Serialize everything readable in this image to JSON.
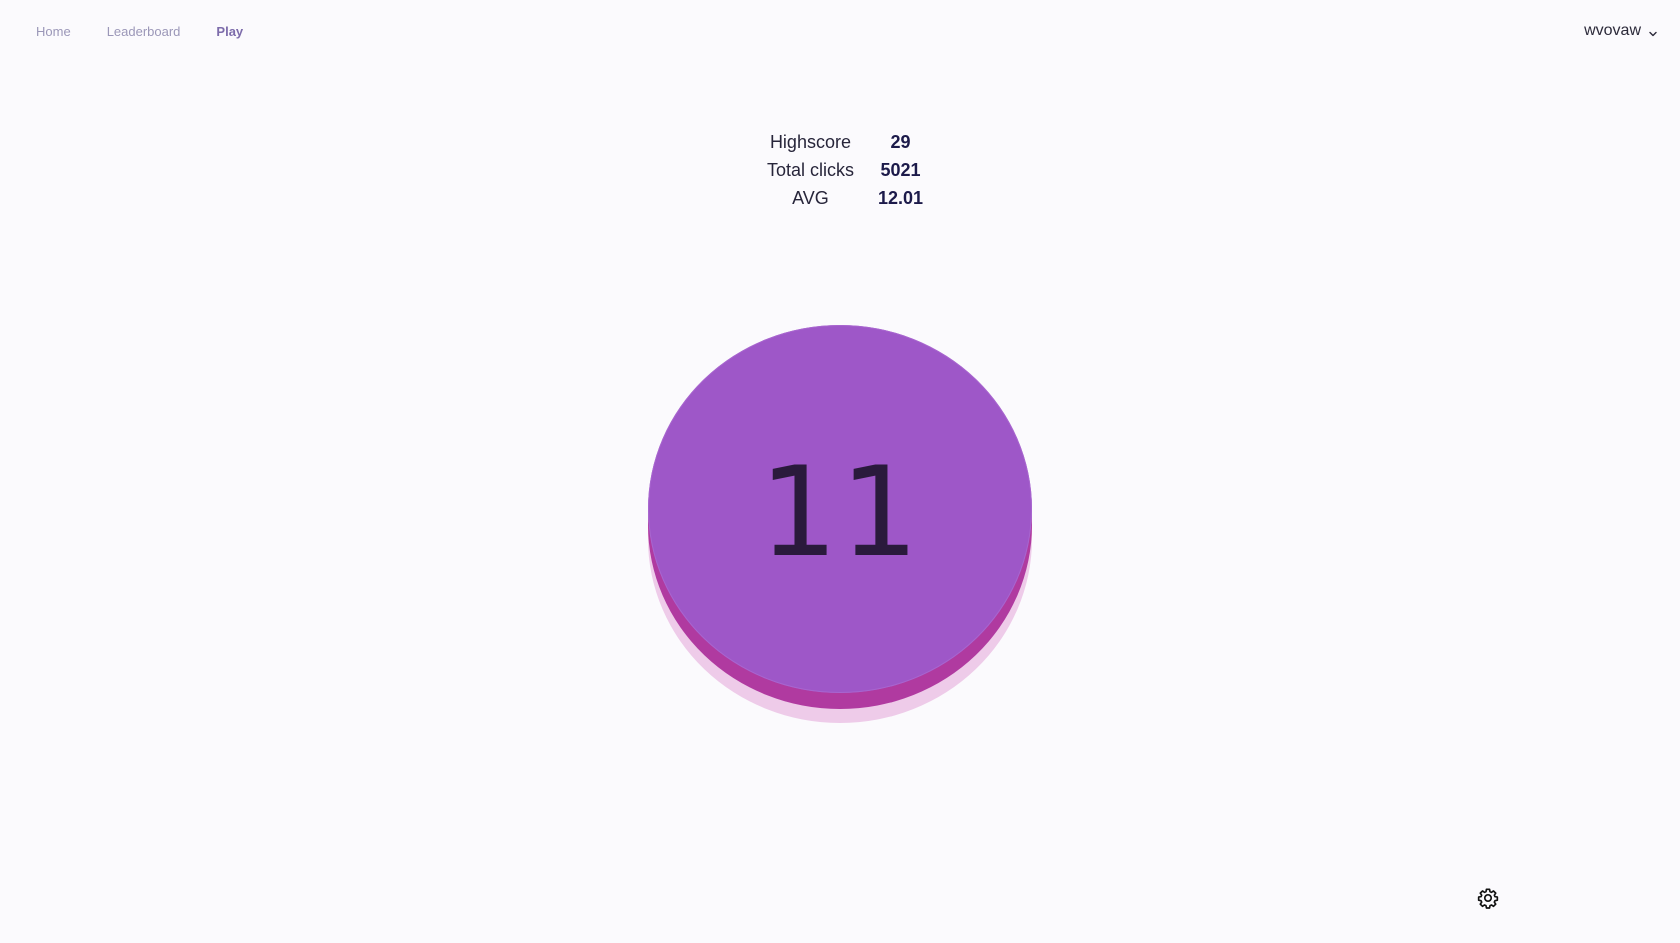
{
  "nav": {
    "home": "Home",
    "leaderboard": "Leaderboard",
    "play": "Play"
  },
  "user": {
    "name": "wvovaw"
  },
  "stats": {
    "highscore_label": "Highscore",
    "highscore_value": "29",
    "total_clicks_label": "Total clicks",
    "total_clicks_value": "5021",
    "avg_label": "AVG",
    "avg_value": "12.01"
  },
  "clicker": {
    "count": "11"
  },
  "icons": {
    "user_menu": "chevron-down-icon",
    "settings": "gear-icon"
  },
  "colors": {
    "button_top": "#9e57c8",
    "button_side": "#b03aa0",
    "button_shadow": "#eecbe9",
    "background": "#fbfafd"
  }
}
